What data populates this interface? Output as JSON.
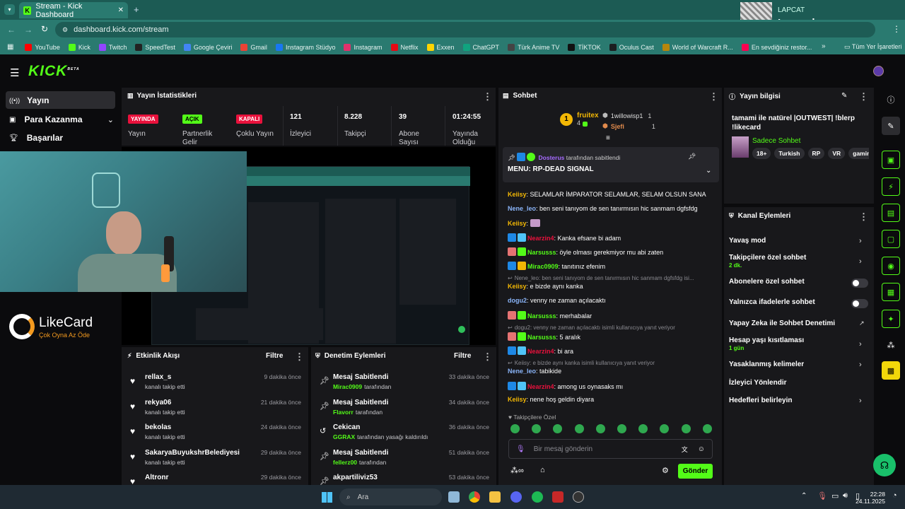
{
  "browser": {
    "tab_title": "Stream - Kick Dashboard",
    "url": "dashboard.kick.com/stream",
    "bookmarks": [
      {
        "label": "YouTube",
        "color": "#ff0000"
      },
      {
        "label": "Kick",
        "color": "#53fc18"
      },
      {
        "label": "Twitch",
        "color": "#9146ff"
      },
      {
        "label": "SpeedTest",
        "color": "#222222"
      },
      {
        "label": "Google Çeviri",
        "color": "#4285f4"
      },
      {
        "label": "Gmail",
        "color": "#ea4335"
      },
      {
        "label": "Instagram Stüdyo",
        "color": "#1877f2"
      },
      {
        "label": "Instagram",
        "color": "#e1306c"
      },
      {
        "label": "Netflix",
        "color": "#e50914"
      },
      {
        "label": "Exxen",
        "color": "#ffd400"
      },
      {
        "label": "ChatGPT",
        "color": "#10a37f"
      },
      {
        "label": "Türk Anime TV",
        "color": "#444444"
      },
      {
        "label": "TİKTOK",
        "color": "#111111"
      },
      {
        "label": "Oculus Cast",
        "color": "#1c1e20"
      },
      {
        "label": "World of Warcraft R...",
        "color": "#b8860b"
      },
      {
        "label": "En sevdiğiniz restor...",
        "color": "#fa0050"
      }
    ],
    "all_bookmarks_label": "Tüm Yer İşaretleri"
  },
  "spotify_widget": {
    "artist": "LAPCAT",
    "title": "Lavender"
  },
  "app": {
    "logo": "KICK",
    "logo_badge": "BETA",
    "sidebar": [
      {
        "label": "Yayın",
        "icon": "broadcast-icon",
        "active": true
      },
      {
        "label": "Para Kazanma",
        "icon": "money-icon"
      },
      {
        "label": "Başarılar",
        "icon": "trophy-icon"
      }
    ],
    "stream_stats": {
      "title": "Yayın İstatistikleri",
      "status_badge": "YAYINDA",
      "status_label": "Yayın",
      "partner_badge": "AÇIK",
      "partner_label": "Partnerlik Gelir",
      "multi_badge": "KAPALI",
      "multi_label": "Çoklu Yayın",
      "viewers": "121",
      "viewers_label": "İzleyici",
      "followers": "8.228",
      "followers_label": "Takipçi",
      "subs": "39",
      "subs_label": "Abone Sayısı",
      "duration": "01:24:55",
      "duration_label": "Yayında Olduğu"
    },
    "likecard": {
      "brand": "LikeCard",
      "tagline": "Çok Oyna Az Öde"
    },
    "activity_feed": {
      "title": "Etkinlik Akışı",
      "filter": "Filtre",
      "items": [
        {
          "name": "rellax_s",
          "sub": "kanalı takip etti",
          "time": "9 dakika önce"
        },
        {
          "name": "rekya06",
          "sub": "kanalı takip etti",
          "time": "21 dakika önce"
        },
        {
          "name": "bekolas",
          "sub": "kanalı takip etti",
          "time": "24 dakika önce"
        },
        {
          "name": "SakaryaBuyukshrBelediyesi",
          "sub": "kanalı takip etti",
          "time": "29 dakika önce"
        },
        {
          "name": "Altronr",
          "sub": "",
          "time": "29 dakika önce"
        }
      ]
    },
    "mod_actions": {
      "title": "Denetim Eylemleri",
      "filter": "Filtre",
      "items": [
        {
          "title": "Mesaj Sabitlendi",
          "user": "Mirac0909",
          "rest": "tarafından",
          "time": "33 dakika önce",
          "icon": "pin-icon"
        },
        {
          "title": "Mesaj Sabitlendi",
          "user": "Flavorr",
          "rest": "tarafından",
          "time": "34 dakika önce",
          "icon": "pin-icon"
        },
        {
          "title": "Cekican",
          "user": "GGRAX",
          "rest": "tarafından yasağı kaldırıldı",
          "time": "36 dakika önce",
          "icon": "undo-icon"
        },
        {
          "title": "Mesaj Sabitlendi",
          "user": "fellerz00",
          "rest": "tarafından",
          "time": "51 dakika önce",
          "icon": "pin-icon"
        },
        {
          "title": "akpartiliviz53",
          "user": "",
          "rest": "",
          "time": "53 dakika önce",
          "icon": "pin-icon"
        }
      ]
    },
    "chat": {
      "title": "Sohbet",
      "top": [
        {
          "rank": "1",
          "name": "fruitex",
          "count": "4"
        },
        {
          "name": "1willowisp1",
          "count": "1"
        },
        {
          "name": "Sjefi",
          "count": "1"
        }
      ],
      "pinned_by_user": "Dosterus",
      "pinned_by_rest": "tarafından sabitlendi",
      "pinned_msg": "MENU: RP-DEAD SIGNAL",
      "messages": [
        {
          "type": "msg",
          "user": "Keiisy",
          "color": "#f2b705",
          "text": "SELAMLAR İMPARATOR SELAMLAR, SELAM OLSUN SANA"
        },
        {
          "type": "msg",
          "user": "Nene_leo",
          "color": "#8ab4f8",
          "text": "ben seni tanıyom de sen tanırmısın hic sanmam dgfsfdg"
        },
        {
          "type": "msg",
          "user": "Keiisy",
          "color": "#f2b705",
          "text": ""
        },
        {
          "type": "msg",
          "user": "Nearzin4",
          "color": "#e9113c",
          "text": "Kanka efsane bi adam"
        },
        {
          "type": "msg",
          "user": "Narsusss",
          "color": "#53fc18",
          "text": "öyle olması gerekmiyor mu abi zaten"
        },
        {
          "type": "msg",
          "user": "Mirac0909",
          "color": "#53fc18",
          "text": "tanıtınız efenim"
        },
        {
          "type": "reply",
          "text": "Nene_leo: ben seni tanıyom de sen tanırmısın hic sanmam dgfsfdg isi..."
        },
        {
          "type": "msg",
          "user": "Keiisy",
          "color": "#f2b705",
          "text": "e bizde aynı kanka"
        },
        {
          "type": "msg",
          "user": "dogu2",
          "color": "#8ab4f8",
          "text": "venny ne zaman açılacaktı"
        },
        {
          "type": "msg",
          "user": "Narsusss",
          "color": "#53fc18",
          "text": "merhabalar"
        },
        {
          "type": "reply",
          "text": "dogu2: venny ne zaman açılacaktı isimli kullanıcıya yanıt veriyor"
        },
        {
          "type": "msg",
          "user": "Narsusss",
          "color": "#53fc18",
          "text": "5 aralık"
        },
        {
          "type": "msg",
          "user": "Nearzin4",
          "color": "#e9113c",
          "text": "bi ara"
        },
        {
          "type": "reply",
          "text": "Keiisy: e bizde aynı kanka isimli kullanıcıya yanıt veriyor"
        },
        {
          "type": "msg",
          "user": "Nene_leo",
          "color": "#8ab4f8",
          "text": "tabikide"
        },
        {
          "type": "msg",
          "user": "Nearzin4",
          "color": "#e9113c",
          "text": "among us oynasaks mı"
        },
        {
          "type": "msg",
          "user": "Keiisy",
          "color": "#f2b705",
          "text": "nene hoş geldin diyara"
        }
      ],
      "followers_only": "Takipçilere Özel",
      "input_placeholder": "Bir mesaj gönderin",
      "send_label": "Gönder"
    },
    "stream_info": {
      "title": "Yayın bilgisi",
      "stream_title": "tamami ile natürel |OUTWEST| !blerp !likecard",
      "category": "Sadece Sohbet",
      "tags": [
        "18+",
        "Turkish",
        "RP",
        "VR",
        "gaming"
      ]
    },
    "channel_actions": {
      "title": "Kanal Eylemleri",
      "items": [
        {
          "label": "Yavaş mod",
          "sub": "",
          "control": "chevron"
        },
        {
          "label": "Takipçilere özel sohbet",
          "sub": "2 dk.",
          "control": "chevron"
        },
        {
          "label": "Abonelere özel sohbet",
          "sub": "",
          "control": "toggle"
        },
        {
          "label": "Yalnızca ifadelerle sohbet",
          "sub": "",
          "control": "toggle"
        },
        {
          "label": "Yapay Zeka ile Sohbet Denetimi",
          "sub": "",
          "control": "external"
        },
        {
          "label": "Hesap yaşı kısıtlaması",
          "sub": "1 gün",
          "control": "chevron"
        },
        {
          "label": "Yasaklanmış kelimeler",
          "sub": "",
          "control": "chevron"
        },
        {
          "label": "İzleyici Yönlendir",
          "sub": "",
          "control": "none"
        },
        {
          "label": "Hedefleri belirleyin",
          "sub": "",
          "control": "chevron"
        }
      ]
    }
  },
  "taskbar": {
    "search": "Ara",
    "time": "22:28",
    "date": "24.11.2025"
  }
}
